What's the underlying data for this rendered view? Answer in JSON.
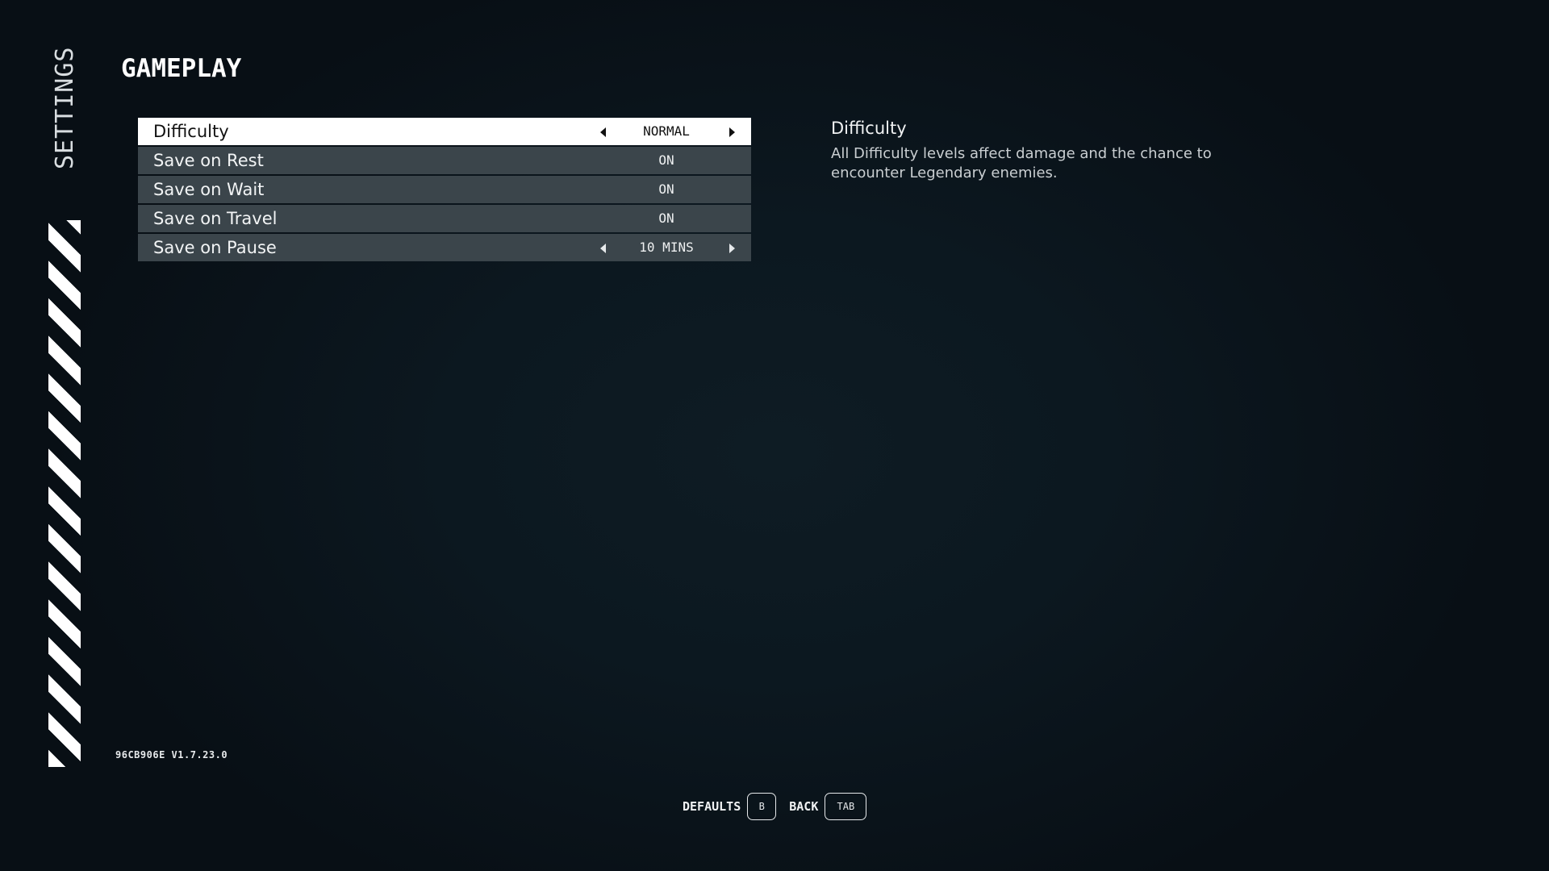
{
  "sidebar": {
    "title": "SETTINGS",
    "decoration": "hazard-stripes"
  },
  "header": {
    "title": "GAMEPLAY"
  },
  "settings": [
    {
      "label": "Difficulty",
      "value": "NORMAL",
      "type": "selector",
      "selected": true
    },
    {
      "label": "Save on Rest",
      "value": "ON",
      "type": "toggle",
      "selected": false
    },
    {
      "label": "Save on Wait",
      "value": "ON",
      "type": "toggle",
      "selected": false
    },
    {
      "label": "Save on Travel",
      "value": "ON",
      "type": "toggle",
      "selected": false
    },
    {
      "label": "Save on Pause",
      "value": "10 MINS",
      "type": "selector",
      "selected": false
    }
  ],
  "description": {
    "title": "Difficulty",
    "body": "All Difficulty levels affect damage and the chance to encounter Legendary enemies."
  },
  "version": "96CB906E V1.7.23.0",
  "footer": {
    "defaults_label": "DEFAULTS",
    "defaults_key": "B",
    "back_label": "BACK",
    "back_key": "TAB"
  },
  "colors": {
    "row_bg": "#3b454b",
    "row_selected_bg": "#ffffff",
    "background": "#0c1820"
  }
}
